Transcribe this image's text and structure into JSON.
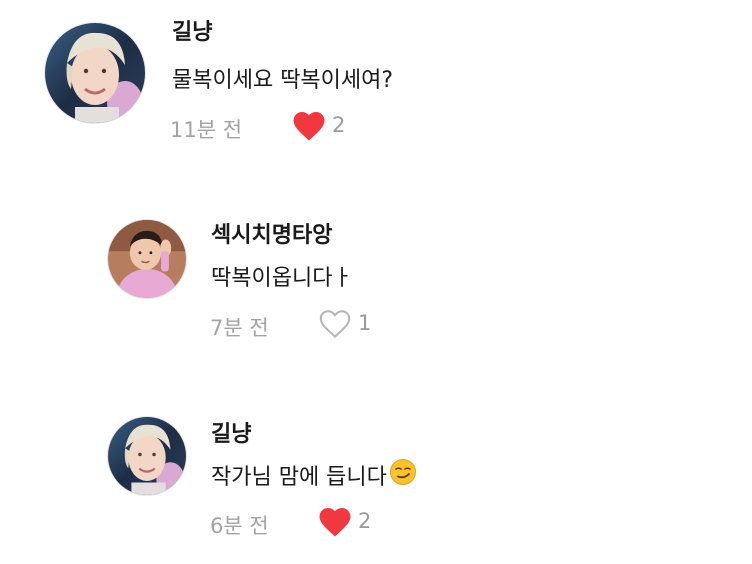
{
  "comments": [
    {
      "author": "길냥",
      "text": "물복이세요 딱복이세여?",
      "time": "11분 전",
      "liked": true,
      "likes": "2",
      "avatar": "blond-person-photo"
    },
    {
      "author": "섹시치명타앙",
      "text": "딱복이옵니다ㅏ",
      "time": "7분 전",
      "liked": false,
      "likes": "1",
      "avatar": "pink-shirt-person-photo"
    },
    {
      "author": "길냥",
      "text": "작가님 맘에 듭니다",
      "emoji": "smirking-face-emoji",
      "time": "6분 전",
      "liked": true,
      "likes": "2",
      "avatar": "blond-person-photo"
    }
  ],
  "colors": {
    "heart_filled": "#f0393f",
    "heart_outline": "#b5b5b5",
    "meta_text": "#a3a3a3"
  }
}
